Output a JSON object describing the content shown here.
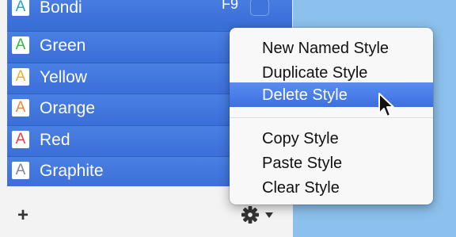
{
  "styles": [
    {
      "name": "Bondi",
      "letter": "A",
      "letter_color": "#22a7c9",
      "shortcut": "F9"
    },
    {
      "name": "Green",
      "letter": "A",
      "letter_color": "#35b64a",
      "shortcut": ""
    },
    {
      "name": "Yellow",
      "letter": "A",
      "letter_color": "#e8b32a",
      "shortcut": ""
    },
    {
      "name": "Orange",
      "letter": "A",
      "letter_color": "#ef8a3a",
      "shortcut": ""
    },
    {
      "name": "Red",
      "letter": "A",
      "letter_color": "#e2444b",
      "shortcut": ""
    },
    {
      "name": "Graphite",
      "letter": "A",
      "letter_color": "#7d87a1",
      "shortcut": ""
    }
  ],
  "footer": {
    "add_label": "+",
    "gear_icon": "gear-icon",
    "dropdown_icon": "triangle-down-icon"
  },
  "context_menu": {
    "items": [
      {
        "label": "New Named Style",
        "highlighted": false
      },
      {
        "label": "Duplicate Style",
        "highlighted": false
      },
      {
        "label": "Delete Style",
        "highlighted": true
      },
      {
        "label": "Copy Style",
        "highlighted": false
      },
      {
        "label": "Paste Style",
        "highlighted": false
      },
      {
        "label": "Clear Style",
        "highlighted": false
      }
    ]
  },
  "colors": {
    "selection_blue": "#3c70d9",
    "menu_highlight": "#3c6fe0",
    "background_blue": "#8cc1ed"
  }
}
